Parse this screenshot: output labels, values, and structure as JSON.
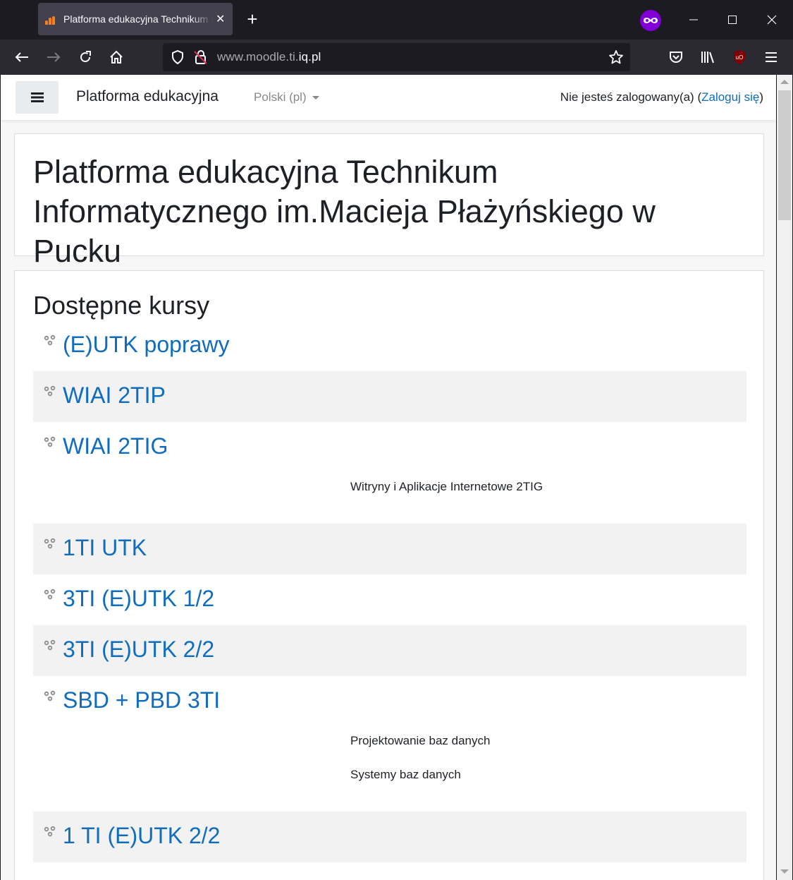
{
  "browser": {
    "tab_title": "Platforma edukacyjna Technikum Informatycznego",
    "url_prefix": "www.moodle.ti.",
    "url_domain": "iq.pl"
  },
  "header": {
    "brand": "Platforma edukacyjna",
    "language": "Polski ‎(pl)‎",
    "login_text": "Nie jesteś zalogowany(a) (",
    "login_link": "Zaloguj się",
    "login_close": ")"
  },
  "site": {
    "title": "Platforma edukacyjna Technikum Informatycznego im.Macieja Płażyńskiego w Pucku"
  },
  "courses": {
    "heading": "Dostępne kursy",
    "items": [
      {
        "name": "(E)UTK poprawy",
        "summary": []
      },
      {
        "name": "WIAI 2TIP",
        "summary": []
      },
      {
        "name": "WIAI 2TIG",
        "summary": [
          "Witryny i Aplikacje Internetowe 2TIG"
        ]
      },
      {
        "name": "1TI UTK",
        "summary": []
      },
      {
        "name": "3TI (E)UTK 1/2",
        "summary": []
      },
      {
        "name": "3TI (E)UTK 2/2",
        "summary": []
      },
      {
        "name": "SBD + PBD 3TI",
        "summary": [
          "Projektowanie baz danych",
          "Systemy baz danych"
        ]
      },
      {
        "name": "1 TI (E)UTK 2/2",
        "summary": []
      }
    ]
  },
  "colors": {
    "link": "#0f6cbf",
    "stripe": "#f2f2f2",
    "chrome_dark": "#1c1b22",
    "chrome_toolbar": "#2b2a33",
    "private_mask": "#8000d7"
  }
}
